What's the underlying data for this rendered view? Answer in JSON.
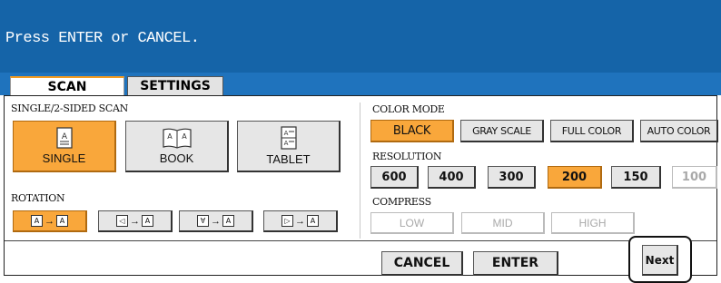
{
  "message": "Press ENTER or CANCEL.",
  "tabs": [
    {
      "label": "SCAN",
      "active": true
    },
    {
      "label": "SETTINGS",
      "active": false
    }
  ],
  "scan_mode": {
    "label": "SINGLE/2-SIDED SCAN",
    "options": [
      {
        "label": "SINGLE",
        "selected": true,
        "icon": "single-page-icon"
      },
      {
        "label": "BOOK",
        "selected": false,
        "icon": "book-icon"
      },
      {
        "label": "TABLET",
        "selected": false,
        "icon": "tablet-icon"
      }
    ]
  },
  "rotation": {
    "label": "ROTATION",
    "glyph": "A",
    "arrow": "→",
    "options": [
      {
        "from": "A",
        "selected": true
      },
      {
        "from": "◁",
        "selected": false
      },
      {
        "from": "∀",
        "selected": false
      },
      {
        "from": "▷",
        "selected": false
      }
    ]
  },
  "color_mode": {
    "label": "COLOR MODE",
    "options": [
      {
        "label": "BLACK",
        "selected": true
      },
      {
        "label": "GRAY SCALE",
        "selected": false
      },
      {
        "label": "FULL COLOR",
        "selected": false
      },
      {
        "label": "AUTO COLOR",
        "selected": false
      }
    ]
  },
  "resolution": {
    "label": "RESOLUTION",
    "options": [
      {
        "label": "600",
        "selected": false,
        "enabled": true
      },
      {
        "label": "400",
        "selected": false,
        "enabled": true
      },
      {
        "label": "300",
        "selected": false,
        "enabled": true
      },
      {
        "label": "200",
        "selected": true,
        "enabled": true
      },
      {
        "label": "150",
        "selected": false,
        "enabled": true
      },
      {
        "label": "100",
        "selected": false,
        "enabled": false
      }
    ]
  },
  "compress": {
    "label": "COMPRESS",
    "options": [
      {
        "label": "LOW",
        "enabled": false
      },
      {
        "label": "MID",
        "enabled": false
      },
      {
        "label": "HIGH",
        "enabled": false
      }
    ]
  },
  "actions": {
    "cancel": "CANCEL",
    "enter": "ENTER",
    "next": "Next"
  },
  "colors": {
    "header": "#1564a8",
    "tab_strip": "#1f73bd",
    "selected": "#f9a73b",
    "button": "#e6e6e6"
  }
}
